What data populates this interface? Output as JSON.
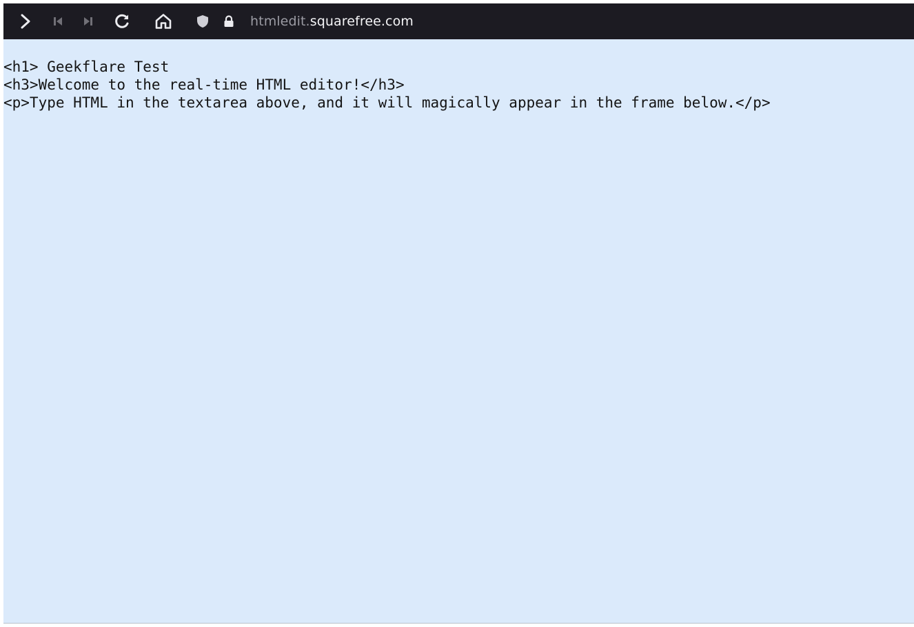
{
  "toolbar": {
    "buttons": [
      {
        "name": "forward",
        "icon": "chevron-right-icon",
        "enabled": true
      },
      {
        "name": "skip-back",
        "icon": "skip-back-icon",
        "enabled": false
      },
      {
        "name": "skip-forward",
        "icon": "skip-forward-icon",
        "enabled": false
      },
      {
        "name": "reload",
        "icon": "reload-icon",
        "enabled": true
      },
      {
        "name": "home",
        "icon": "home-icon",
        "enabled": true
      }
    ],
    "url": {
      "subdomain": "htmledit.",
      "domain": "squarefree.com"
    },
    "indicators": [
      "shield-icon",
      "lock-icon"
    ]
  },
  "editor": {
    "lines": [
      "<h1> Geekflare Test",
      "<h3>Welcome to the real-time HTML editor!</h3>",
      "<p>Type HTML in the textarea above, and it will magically appear in the frame below.</p>"
    ]
  },
  "colors": {
    "toolbar_bg": "#1c1b22",
    "content_bg": "#dbeafb",
    "text": "#141414"
  }
}
